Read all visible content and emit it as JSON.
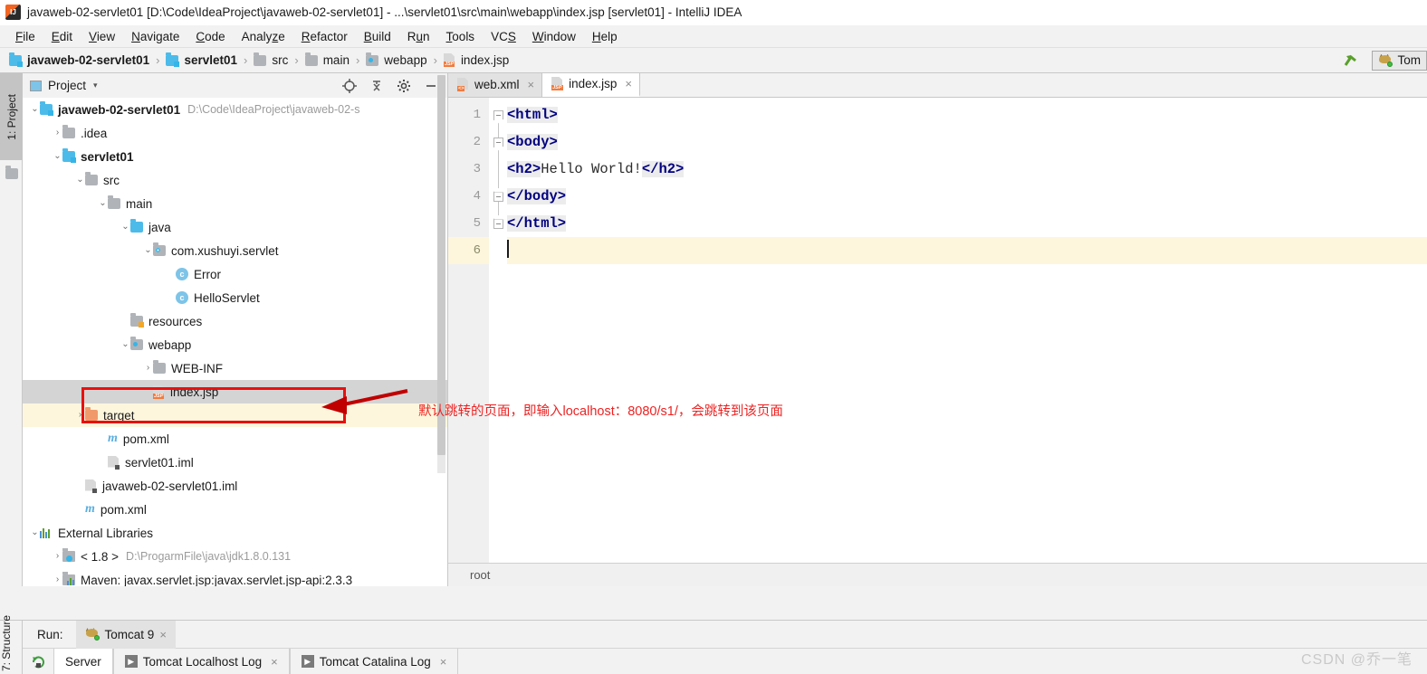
{
  "window": {
    "title": "javaweb-02-servlet01 [D:\\Code\\IdeaProject\\javaweb-02-servlet01] - ...\\servlet01\\src\\main\\webapp\\index.jsp [servlet01] - IntelliJ IDEA",
    "app_icon": "intellij-idea-icon"
  },
  "menubar": {
    "items": [
      {
        "label": "File",
        "mnemonic": "F"
      },
      {
        "label": "Edit",
        "mnemonic": "E"
      },
      {
        "label": "View",
        "mnemonic": "V"
      },
      {
        "label": "Navigate",
        "mnemonic": "N"
      },
      {
        "label": "Code",
        "mnemonic": "C"
      },
      {
        "label": "Analyze",
        "mnemonic": "z"
      },
      {
        "label": "Refactor",
        "mnemonic": "R"
      },
      {
        "label": "Build",
        "mnemonic": "B"
      },
      {
        "label": "Run",
        "mnemonic": "u"
      },
      {
        "label": "Tools",
        "mnemonic": "T"
      },
      {
        "label": "VCS",
        "mnemonic": "S"
      },
      {
        "label": "Window",
        "mnemonic": "W"
      },
      {
        "label": "Help",
        "mnemonic": "H"
      }
    ]
  },
  "navbar": {
    "crumbs": [
      {
        "label": "javaweb-02-servlet01",
        "icon": "module-folder-icon",
        "bold": true
      },
      {
        "label": "servlet01",
        "icon": "module-folder-icon",
        "bold": true
      },
      {
        "label": "src",
        "icon": "folder-icon",
        "bold": false
      },
      {
        "label": "main",
        "icon": "folder-icon",
        "bold": false
      },
      {
        "label": "webapp",
        "icon": "web-folder-icon",
        "bold": false
      },
      {
        "label": "index.jsp",
        "icon": "jsp-file-icon",
        "bold": false
      }
    ],
    "separator": "›",
    "build_icon": "build-hammer-icon",
    "run_config": {
      "label": "Tom",
      "icon": "tomcat-icon"
    }
  },
  "rail": {
    "project_tab": "1: Project",
    "structure_tab": "7: Structure"
  },
  "project_panel": {
    "title": "Project",
    "caret": "▾",
    "tools": [
      "locate-icon",
      "collapse-all-icon",
      "settings-gear-icon",
      "minimize-icon"
    ],
    "tree": [
      {
        "label": "javaweb-02-servlet01",
        "sub": "D:\\Code\\IdeaProject\\javaweb-02-s",
        "indent": 0,
        "chevron": "⌄",
        "icon": "module-folder-icon",
        "bold": true,
        "state": "normal"
      },
      {
        "label": ".idea",
        "sub": "",
        "indent": 1,
        "chevron": "›",
        "icon": "folder-icon",
        "bold": false,
        "state": "normal"
      },
      {
        "label": "servlet01",
        "sub": "",
        "indent": 1,
        "chevron": "⌄",
        "icon": "module-folder-icon",
        "bold": true,
        "state": "normal"
      },
      {
        "label": "src",
        "sub": "",
        "indent": 2,
        "chevron": "⌄",
        "icon": "folder-icon",
        "bold": false,
        "state": "normal"
      },
      {
        "label": "main",
        "sub": "",
        "indent": 3,
        "chevron": "⌄",
        "icon": "folder-icon",
        "bold": false,
        "state": "normal"
      },
      {
        "label": "java",
        "sub": "",
        "indent": 4,
        "chevron": "⌄",
        "icon": "source-folder-icon",
        "bold": false,
        "state": "normal"
      },
      {
        "label": "com.xushuyi.servlet",
        "sub": "",
        "indent": 5,
        "chevron": "⌄",
        "icon": "package-icon",
        "bold": false,
        "state": "normal"
      },
      {
        "label": "Error",
        "sub": "",
        "indent": 6,
        "chevron": "",
        "icon": "java-class-icon",
        "bold": false,
        "state": "normal"
      },
      {
        "label": "HelloServlet",
        "sub": "",
        "indent": 6,
        "chevron": "",
        "icon": "java-class-icon",
        "bold": false,
        "state": "normal"
      },
      {
        "label": "resources",
        "sub": "",
        "indent": 4,
        "chevron": "",
        "icon": "resources-folder-icon",
        "bold": false,
        "state": "normal"
      },
      {
        "label": "webapp",
        "sub": "",
        "indent": 4,
        "chevron": "⌄",
        "icon": "web-folder-icon",
        "bold": false,
        "state": "normal"
      },
      {
        "label": "WEB-INF",
        "sub": "",
        "indent": 5,
        "chevron": "›",
        "icon": "folder-icon",
        "bold": false,
        "state": "normal"
      },
      {
        "label": "index.jsp",
        "sub": "",
        "indent": 5,
        "chevron": "",
        "icon": "jsp-file-icon",
        "bold": false,
        "state": "selected"
      },
      {
        "label": "target",
        "sub": "",
        "indent": 2,
        "chevron": "›",
        "icon": "target-folder-icon",
        "bold": false,
        "state": "highlight"
      },
      {
        "label": "pom.xml",
        "sub": "",
        "indent": 3,
        "chevron": "",
        "icon": "maven-m-icon",
        "bold": false,
        "state": "normal"
      },
      {
        "label": "servlet01.iml",
        "sub": "",
        "indent": 3,
        "chevron": "",
        "icon": "iml-file-icon",
        "bold": false,
        "state": "normal"
      },
      {
        "label": "javaweb-02-servlet01.iml",
        "sub": "",
        "indent": 2,
        "chevron": "",
        "icon": "iml-file-icon",
        "bold": false,
        "state": "normal"
      },
      {
        "label": "pom.xml",
        "sub": "",
        "indent": 2,
        "chevron": "",
        "icon": "maven-m-icon",
        "bold": false,
        "state": "normal"
      },
      {
        "label": "External Libraries",
        "sub": "",
        "indent": 0,
        "chevron": "⌄",
        "icon": "libraries-icon",
        "bold": false,
        "state": "normal"
      },
      {
        "label": "< 1.8 >",
        "sub": "D:\\ProgarmFile\\java\\jdk1.8.0.131",
        "indent": 1,
        "chevron": "›",
        "icon": "jdk-icon",
        "bold": false,
        "state": "normal"
      },
      {
        "label": "Maven: javax.servlet.jsp:javax.servlet.jsp-api:2.3.3",
        "sub": "",
        "indent": 1,
        "chevron": "›",
        "icon": "maven-lib-icon",
        "bold": false,
        "state": "normal"
      }
    ]
  },
  "editor": {
    "tabs": [
      {
        "label": "web.xml",
        "icon": "xml-file-icon",
        "active": false,
        "close": "×"
      },
      {
        "label": "index.jsp",
        "icon": "jsp-file-icon",
        "active": true,
        "close": "×"
      }
    ],
    "lines": [
      {
        "number": "1",
        "fold": "down",
        "segments": [
          {
            "t": "<html>",
            "k": "tag"
          }
        ]
      },
      {
        "number": "2",
        "fold": "down",
        "segments": [
          {
            "t": "<body>",
            "k": "tag"
          }
        ]
      },
      {
        "number": "3",
        "fold": "",
        "segments": [
          {
            "t": "<h2>",
            "k": "tag"
          },
          {
            "t": "Hello World!",
            "k": "text"
          },
          {
            "t": "</h2>",
            "k": "tag"
          }
        ]
      },
      {
        "number": "4",
        "fold": "up",
        "segments": [
          {
            "t": "</body>",
            "k": "tag"
          }
        ]
      },
      {
        "number": "5",
        "fold": "up",
        "segments": [
          {
            "t": "</html>",
            "k": "tag"
          }
        ]
      },
      {
        "number": "6",
        "fold": "",
        "segments": [],
        "current": true
      }
    ],
    "status": "root"
  },
  "annotation": {
    "text": "默认跳转的页面，即输入localhost：8080/s1/，会跳转到该页面",
    "box_color": "#e8100f",
    "arrow_color": "#c00000",
    "text_color": "#ee2222"
  },
  "run_panel": {
    "run_label": "Run:",
    "config_tab": {
      "label": "Tomcat 9",
      "icon": "tomcat-icon",
      "close": "×"
    },
    "rerun_icon": "rerun-icon",
    "log_tabs": [
      {
        "label": "Server",
        "icon": "",
        "selected": true,
        "close": ""
      },
      {
        "label": "Tomcat Localhost Log",
        "icon": "play-icon",
        "selected": false,
        "close": "×"
      },
      {
        "label": "Tomcat Catalina Log",
        "icon": "play-icon",
        "selected": false,
        "close": "×"
      }
    ]
  },
  "watermark": "CSDN @乔一笔"
}
